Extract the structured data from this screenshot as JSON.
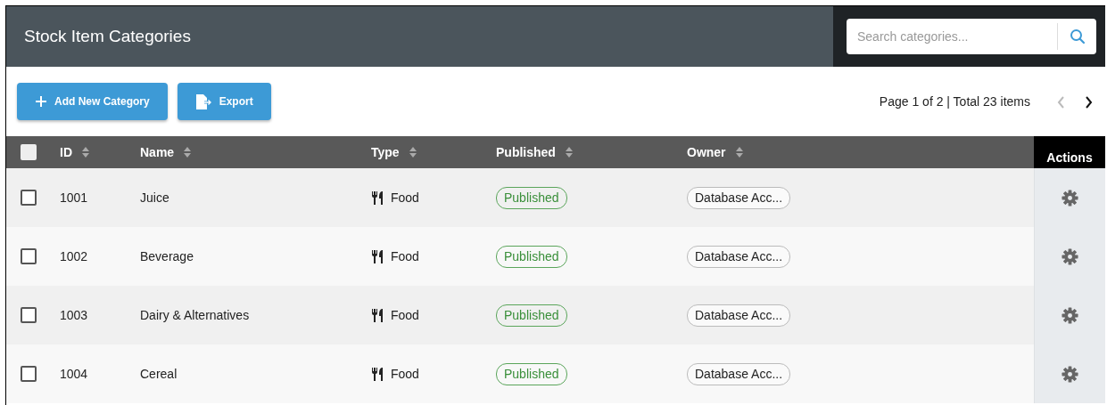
{
  "header": {
    "title": "Stock Item Categories",
    "search": {
      "placeholder": "Search categories..."
    }
  },
  "toolbar": {
    "buttons": [
      {
        "label": "Add New Category",
        "kind": "add"
      },
      {
        "label": "Export",
        "kind": "export"
      }
    ],
    "pagination": {
      "text": "Page 1 of 2 | Total 23 items",
      "prev_disabled": true,
      "next_disabled": false
    }
  },
  "table": {
    "select_all": {
      "checked": false
    },
    "columns": [
      {
        "label": "ID",
        "sortable": true
      },
      {
        "label": "Name",
        "sortable": true
      },
      {
        "label": "Type",
        "sortable": true
      },
      {
        "label": "Published",
        "sortable": true
      },
      {
        "label": "Owner",
        "sortable": true
      },
      {
        "label": "Actions",
        "sortable": false
      }
    ],
    "rows": [
      {
        "checked": false,
        "id": "1001",
        "name": "Juice",
        "type": "Food",
        "published": "Published",
        "owner": "Database Acc..."
      },
      {
        "checked": false,
        "id": "1002",
        "name": "Beverage",
        "type": "Food",
        "published": "Published",
        "owner": "Database Acc..."
      },
      {
        "checked": false,
        "id": "1003",
        "name": "Dairy & Alternatives",
        "type": "Food",
        "published": "Published",
        "owner": "Database Acc..."
      },
      {
        "checked": false,
        "id": "1004",
        "name": "Cereal",
        "type": "Food",
        "published": "Published",
        "owner": "Database Acc..."
      }
    ]
  }
}
